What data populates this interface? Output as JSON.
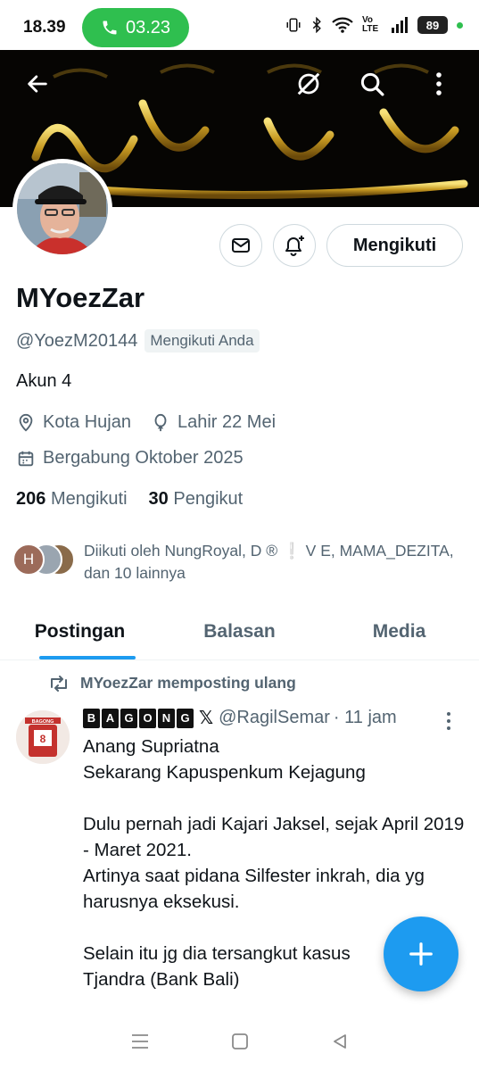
{
  "status_bar": {
    "time": "18.39",
    "call_duration": "03.23",
    "battery": "89",
    "network": "Vo LTE"
  },
  "profile": {
    "name": "MYoezZar",
    "handle": "@YoezM20144",
    "follows_you": "Mengikuti Anda",
    "bio": "Akun 4",
    "location": "Kota Hujan",
    "birthday": "Lahir 22 Mei",
    "joined": "Bergabung Oktober 2025",
    "following_count": "206",
    "following_label": "Mengikuti",
    "followers_count": "30",
    "followers_label": "Pengikut",
    "follow_button": "Mengikuti",
    "followed_by": "Diikuti oleh NungRoyal, D ® ❕ V E, MAMA_DEZITA, dan 10 lainnya",
    "followed_by_initial": "H"
  },
  "tabs": [
    {
      "label": "Postingan",
      "active": true
    },
    {
      "label": "Balasan",
      "active": false
    },
    {
      "label": "Media",
      "active": false
    }
  ],
  "post": {
    "repost_label": "MYoezZar memposting ulang",
    "author_letters": [
      "B",
      "A",
      "G",
      "O",
      "N",
      "G"
    ],
    "author_badge": "𝕏",
    "author_handle": "@RagilSemar",
    "time": "· 11 jam",
    "avatar_caption": "BAGONG",
    "lines": [
      "Anang Supriatna",
      "Sekarang Kapuspenkum Kejagung",
      "",
      "Dulu pernah jadi Kajari Jaksel, sejak April 2019 - Maret 2021.",
      "Artinya saat pidana Silfester inkrah, dia yg harusnya eksekusi.",
      "",
      "Selain itu jg dia tersangkut kasus",
      "Tjandra (Bank Bali)"
    ]
  },
  "colors": {
    "accent": "#1d9bf0",
    "call_green": "#2fbf4f",
    "secondary_text": "#536471"
  }
}
